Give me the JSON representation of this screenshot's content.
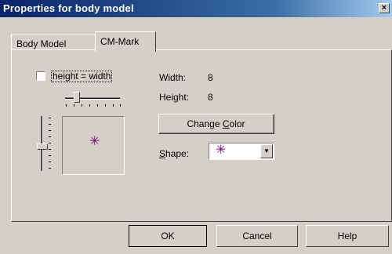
{
  "window": {
    "title": "Properties for body model",
    "close_glyph": "×"
  },
  "tabs": [
    {
      "label": "Body Model",
      "active": false
    },
    {
      "label": "CM-Mark",
      "active": true
    }
  ],
  "cm_mark": {
    "checkbox_label": "height = width",
    "checkbox_checked": false,
    "width_label": "Width:",
    "width_value": "8",
    "height_label": "Height:",
    "height_value": "8",
    "change_color_prefix": "Change ",
    "change_color_mnemonic": "C",
    "change_color_suffix": "olor",
    "shape_mnemonic": "S",
    "shape_suffix": "hape:",
    "shape_value": "✳",
    "preview_mark": "✳",
    "mark_color": "#800080"
  },
  "buttons": {
    "ok": "OK",
    "cancel": "Cancel",
    "help": "Help"
  },
  "icons": {
    "dropdown": "chevron-down-icon",
    "close": "close-icon"
  }
}
